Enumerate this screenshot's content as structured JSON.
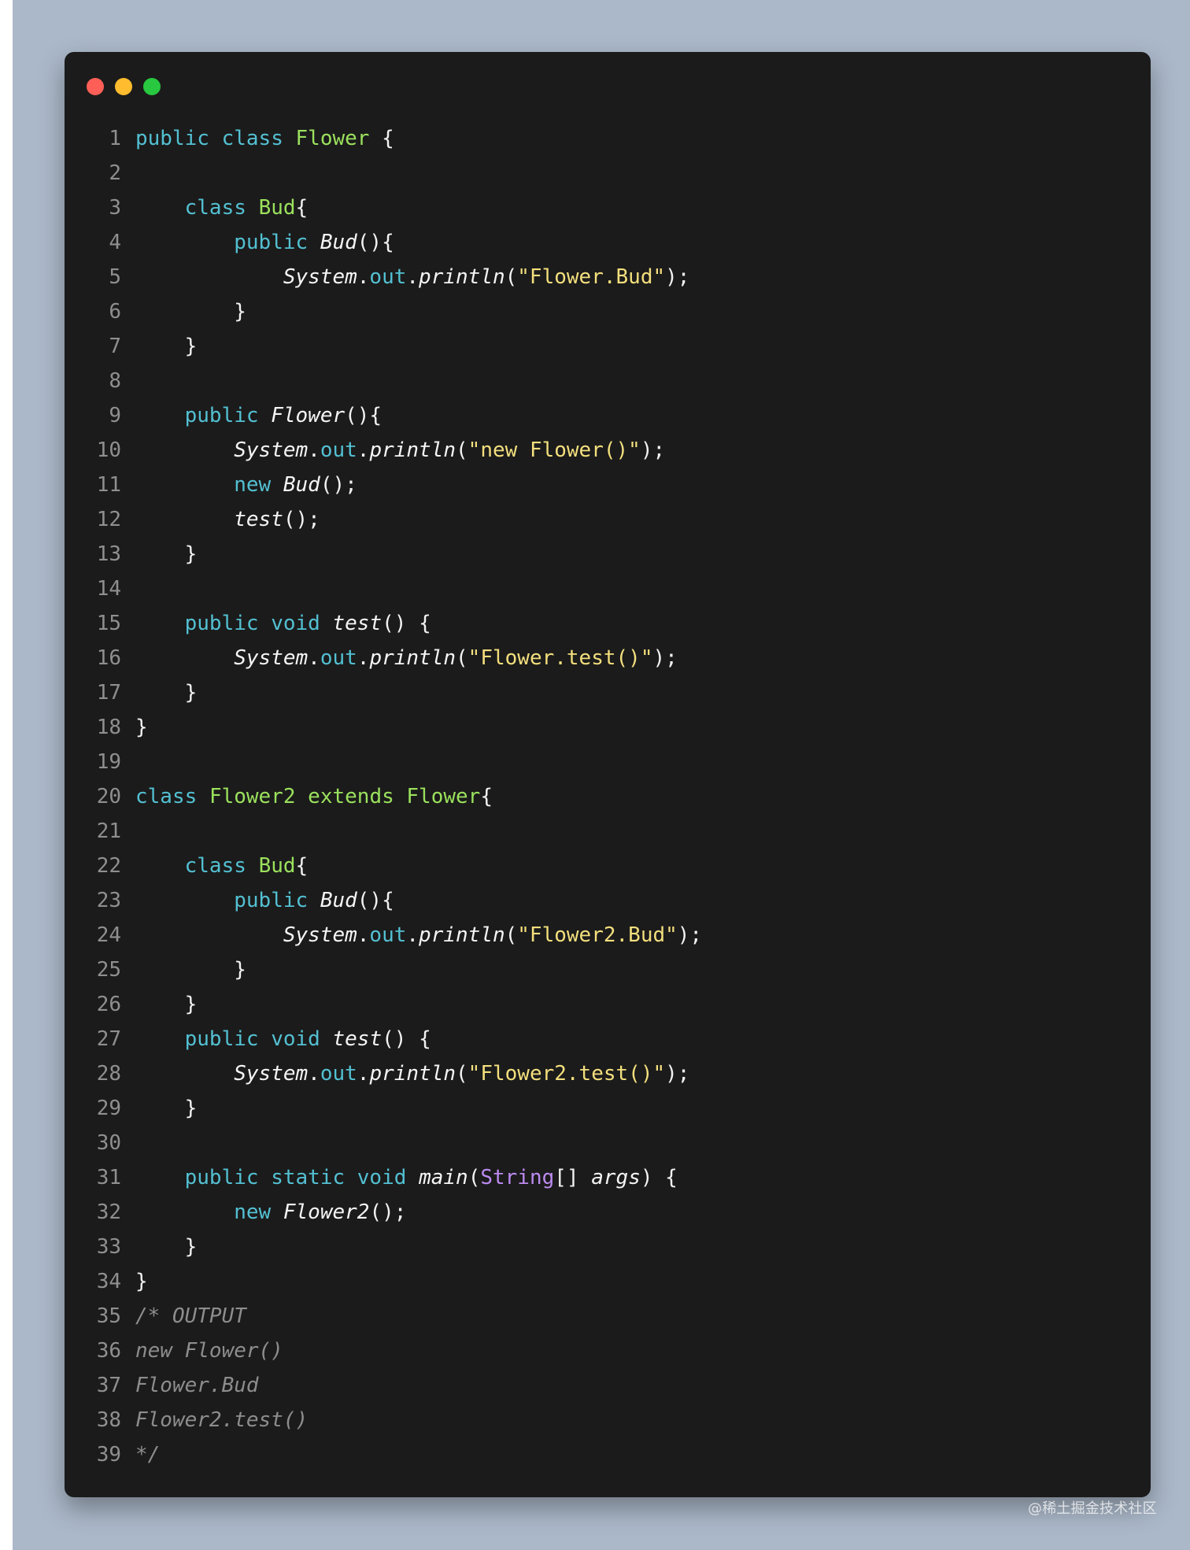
{
  "window": {
    "controls": [
      {
        "name": "close",
        "color": "#ff5f57"
      },
      {
        "name": "minimize",
        "color": "#febc2e"
      },
      {
        "name": "maximize",
        "color": "#28c840"
      }
    ]
  },
  "code": {
    "lines": [
      {
        "number": "1",
        "tokens": [
          {
            "t": "public",
            "c": "kw"
          },
          {
            "t": " "
          },
          {
            "t": "class",
            "c": "kw"
          },
          {
            "t": " "
          },
          {
            "t": "Flower",
            "c": "cls"
          },
          {
            "t": " {"
          }
        ]
      },
      {
        "number": "2",
        "tokens": []
      },
      {
        "number": "3",
        "tokens": [
          {
            "t": "    "
          },
          {
            "t": "class",
            "c": "kw"
          },
          {
            "t": " "
          },
          {
            "t": "Bud",
            "c": "cls"
          },
          {
            "t": "{"
          }
        ]
      },
      {
        "number": "4",
        "tokens": [
          {
            "t": "        "
          },
          {
            "t": "public",
            "c": "kw"
          },
          {
            "t": " "
          },
          {
            "t": "Bud",
            "c": "fn"
          },
          {
            "t": "(){"
          }
        ]
      },
      {
        "number": "5",
        "tokens": [
          {
            "t": "            "
          },
          {
            "t": "System",
            "c": "fn"
          },
          {
            "t": "."
          },
          {
            "t": "out",
            "c": "field"
          },
          {
            "t": "."
          },
          {
            "t": "println",
            "c": "fn"
          },
          {
            "t": "("
          },
          {
            "t": "\"Flower.Bud\"",
            "c": "str"
          },
          {
            "t": ");"
          }
        ]
      },
      {
        "number": "6",
        "tokens": [
          {
            "t": "        }"
          }
        ]
      },
      {
        "number": "7",
        "tokens": [
          {
            "t": "    }"
          }
        ]
      },
      {
        "number": "8",
        "tokens": []
      },
      {
        "number": "9",
        "tokens": [
          {
            "t": "    "
          },
          {
            "t": "public",
            "c": "kw"
          },
          {
            "t": " "
          },
          {
            "t": "Flower",
            "c": "fn"
          },
          {
            "t": "(){"
          }
        ]
      },
      {
        "number": "10",
        "tokens": [
          {
            "t": "        "
          },
          {
            "t": "System",
            "c": "fn"
          },
          {
            "t": "."
          },
          {
            "t": "out",
            "c": "field"
          },
          {
            "t": "."
          },
          {
            "t": "println",
            "c": "fn"
          },
          {
            "t": "("
          },
          {
            "t": "\"new Flower()\"",
            "c": "str"
          },
          {
            "t": ");"
          }
        ]
      },
      {
        "number": "11",
        "tokens": [
          {
            "t": "        "
          },
          {
            "t": "new",
            "c": "kw"
          },
          {
            "t": " "
          },
          {
            "t": "Bud",
            "c": "fn"
          },
          {
            "t": "();"
          }
        ]
      },
      {
        "number": "12",
        "tokens": [
          {
            "t": "        "
          },
          {
            "t": "test",
            "c": "fn"
          },
          {
            "t": "();"
          }
        ]
      },
      {
        "number": "13",
        "tokens": [
          {
            "t": "    }"
          }
        ]
      },
      {
        "number": "14",
        "tokens": []
      },
      {
        "number": "15",
        "tokens": [
          {
            "t": "    "
          },
          {
            "t": "public",
            "c": "kw"
          },
          {
            "t": " "
          },
          {
            "t": "void",
            "c": "kw"
          },
          {
            "t": " "
          },
          {
            "t": "test",
            "c": "fn"
          },
          {
            "t": "() {"
          }
        ]
      },
      {
        "number": "16",
        "tokens": [
          {
            "t": "        "
          },
          {
            "t": "System",
            "c": "fn"
          },
          {
            "t": "."
          },
          {
            "t": "out",
            "c": "field"
          },
          {
            "t": "."
          },
          {
            "t": "println",
            "c": "fn"
          },
          {
            "t": "("
          },
          {
            "t": "\"Flower.test()\"",
            "c": "str"
          },
          {
            "t": ");"
          }
        ]
      },
      {
        "number": "17",
        "tokens": [
          {
            "t": "    }"
          }
        ]
      },
      {
        "number": "18",
        "tokens": [
          {
            "t": "}"
          }
        ]
      },
      {
        "number": "19",
        "tokens": []
      },
      {
        "number": "20",
        "tokens": [
          {
            "t": "class",
            "c": "kw"
          },
          {
            "t": " "
          },
          {
            "t": "Flower2",
            "c": "cls"
          },
          {
            "t": " "
          },
          {
            "t": "extends",
            "c": "cls"
          },
          {
            "t": " "
          },
          {
            "t": "Flower",
            "c": "cls"
          },
          {
            "t": "{"
          }
        ]
      },
      {
        "number": "21",
        "tokens": []
      },
      {
        "number": "22",
        "tokens": [
          {
            "t": "    "
          },
          {
            "t": "class",
            "c": "kw"
          },
          {
            "t": " "
          },
          {
            "t": "Bud",
            "c": "cls"
          },
          {
            "t": "{"
          }
        ]
      },
      {
        "number": "23",
        "tokens": [
          {
            "t": "        "
          },
          {
            "t": "public",
            "c": "kw"
          },
          {
            "t": " "
          },
          {
            "t": "Bud",
            "c": "fn"
          },
          {
            "t": "(){"
          }
        ]
      },
      {
        "number": "24",
        "tokens": [
          {
            "t": "            "
          },
          {
            "t": "System",
            "c": "fn"
          },
          {
            "t": "."
          },
          {
            "t": "out",
            "c": "field"
          },
          {
            "t": "."
          },
          {
            "t": "println",
            "c": "fn"
          },
          {
            "t": "("
          },
          {
            "t": "\"Flower2.Bud\"",
            "c": "str"
          },
          {
            "t": ");"
          }
        ]
      },
      {
        "number": "25",
        "tokens": [
          {
            "t": "        }"
          }
        ]
      },
      {
        "number": "26",
        "tokens": [
          {
            "t": "    }"
          }
        ]
      },
      {
        "number": "27",
        "tokens": [
          {
            "t": "    "
          },
          {
            "t": "public",
            "c": "kw"
          },
          {
            "t": " "
          },
          {
            "t": "void",
            "c": "kw"
          },
          {
            "t": " "
          },
          {
            "t": "test",
            "c": "fn"
          },
          {
            "t": "() {"
          }
        ]
      },
      {
        "number": "28",
        "tokens": [
          {
            "t": "        "
          },
          {
            "t": "System",
            "c": "fn"
          },
          {
            "t": "."
          },
          {
            "t": "out",
            "c": "field"
          },
          {
            "t": "."
          },
          {
            "t": "println",
            "c": "fn"
          },
          {
            "t": "("
          },
          {
            "t": "\"Flower2.test()\"",
            "c": "str"
          },
          {
            "t": ");"
          }
        ]
      },
      {
        "number": "29",
        "tokens": [
          {
            "t": "    }"
          }
        ]
      },
      {
        "number": "30",
        "tokens": []
      },
      {
        "number": "31",
        "tokens": [
          {
            "t": "    "
          },
          {
            "t": "public",
            "c": "kw"
          },
          {
            "t": " "
          },
          {
            "t": "static",
            "c": "kw"
          },
          {
            "t": " "
          },
          {
            "t": "void",
            "c": "kw"
          },
          {
            "t": " "
          },
          {
            "t": "main",
            "c": "fn"
          },
          {
            "t": "("
          },
          {
            "t": "String",
            "c": "type"
          },
          {
            "t": "[] "
          },
          {
            "t": "args",
            "c": "param"
          },
          {
            "t": ") {"
          }
        ]
      },
      {
        "number": "32",
        "tokens": [
          {
            "t": "        "
          },
          {
            "t": "new",
            "c": "kw"
          },
          {
            "t": " "
          },
          {
            "t": "Flower2",
            "c": "fn"
          },
          {
            "t": "();"
          }
        ]
      },
      {
        "number": "33",
        "tokens": [
          {
            "t": "    }"
          }
        ]
      },
      {
        "number": "34",
        "tokens": [
          {
            "t": "}"
          }
        ]
      },
      {
        "number": "35",
        "tokens": [
          {
            "t": "/* OUTPUT",
            "c": "cmt"
          }
        ]
      },
      {
        "number": "36",
        "tokens": [
          {
            "t": "new Flower()",
            "c": "cmt"
          }
        ]
      },
      {
        "number": "37",
        "tokens": [
          {
            "t": "Flower.Bud",
            "c": "cmt"
          }
        ]
      },
      {
        "number": "38",
        "tokens": [
          {
            "t": "Flower2.test()",
            "c": "cmt"
          }
        ]
      },
      {
        "number": "39",
        "tokens": [
          {
            "t": "*/",
            "c": "cmt"
          }
        ]
      }
    ]
  },
  "watermark": "@稀土掘金技术社区"
}
